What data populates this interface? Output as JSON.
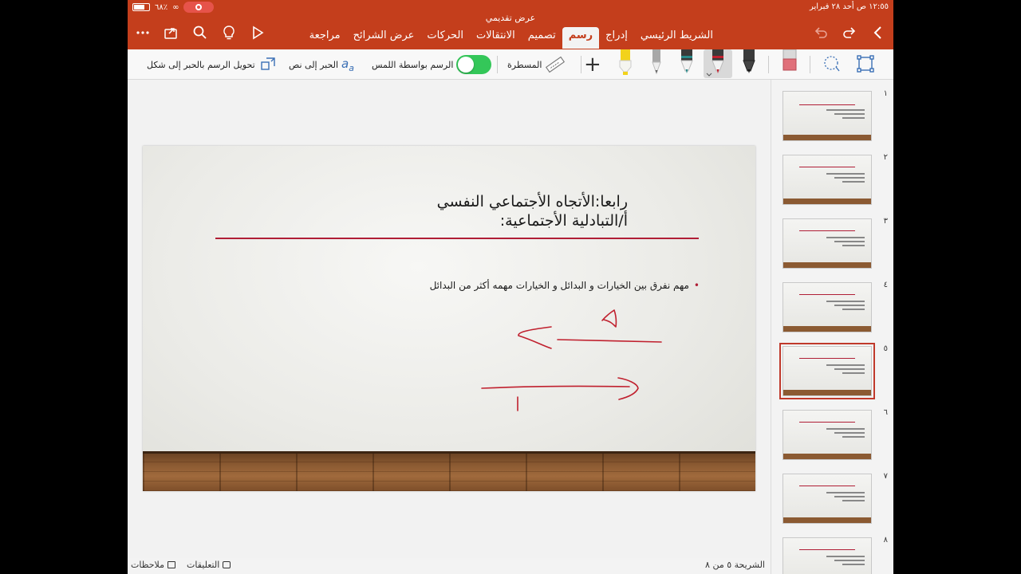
{
  "status": {
    "time": "١٢:٥٥ ص   أحد ٢٨ فبراير",
    "battery": "٦٨٪"
  },
  "document": {
    "title": "عرض تقديمي"
  },
  "tabs": [
    {
      "label": "الشريط الرئيسي"
    },
    {
      "label": "إدراج"
    },
    {
      "label": "رسم",
      "active": true
    },
    {
      "label": "تصميم"
    },
    {
      "label": "الانتقالات"
    },
    {
      "label": "الحركات"
    },
    {
      "label": "عرض الشرائح"
    },
    {
      "label": "مراجعة"
    }
  ],
  "ribbon": {
    "ruler_label": "المسطرة",
    "draw_with_touch_label": "الرسم بواسطة اللمس",
    "ink_to_text_label": "الحبر إلى نص",
    "ink_to_shape_label": "تحويل الرسم بالحبر إلى شكل",
    "pens": [
      {
        "name": "highlighter-yellow",
        "color": "#f2d21b"
      },
      {
        "name": "pencil-gray",
        "color": "#9a9a9a"
      },
      {
        "name": "pen-teal",
        "color": "#2a8a8a"
      },
      {
        "name": "pen-red",
        "color": "#c0202e",
        "selected": true
      },
      {
        "name": "pen-black",
        "color": "#222222"
      },
      {
        "name": "eraser",
        "color": "#e0707a"
      }
    ]
  },
  "slide": {
    "title_line1": "رابعا:الأتجاه الأجتماعي النفسي",
    "title_line2": "أ/التبادلية الأجتماعية:",
    "bullet": "مهم نفرق بين الخيارات و البدائل و الخيارات مهمه أكثر من البدائل"
  },
  "thumbnails": [
    {
      "number": "١"
    },
    {
      "number": "٢"
    },
    {
      "number": "٣"
    },
    {
      "number": "٤"
    },
    {
      "number": "٥",
      "selected": true
    },
    {
      "number": "٦"
    },
    {
      "number": "٧"
    },
    {
      "number": "٨"
    }
  ],
  "statusbar": {
    "slide_counter": "الشريحة ٥ من ٨",
    "notes_label": "ملاحظات",
    "comments_label": "التعليقات"
  },
  "colors": {
    "accent": "#c43e1c",
    "ink_red": "#c0202e",
    "toggle_on": "#34c759"
  }
}
